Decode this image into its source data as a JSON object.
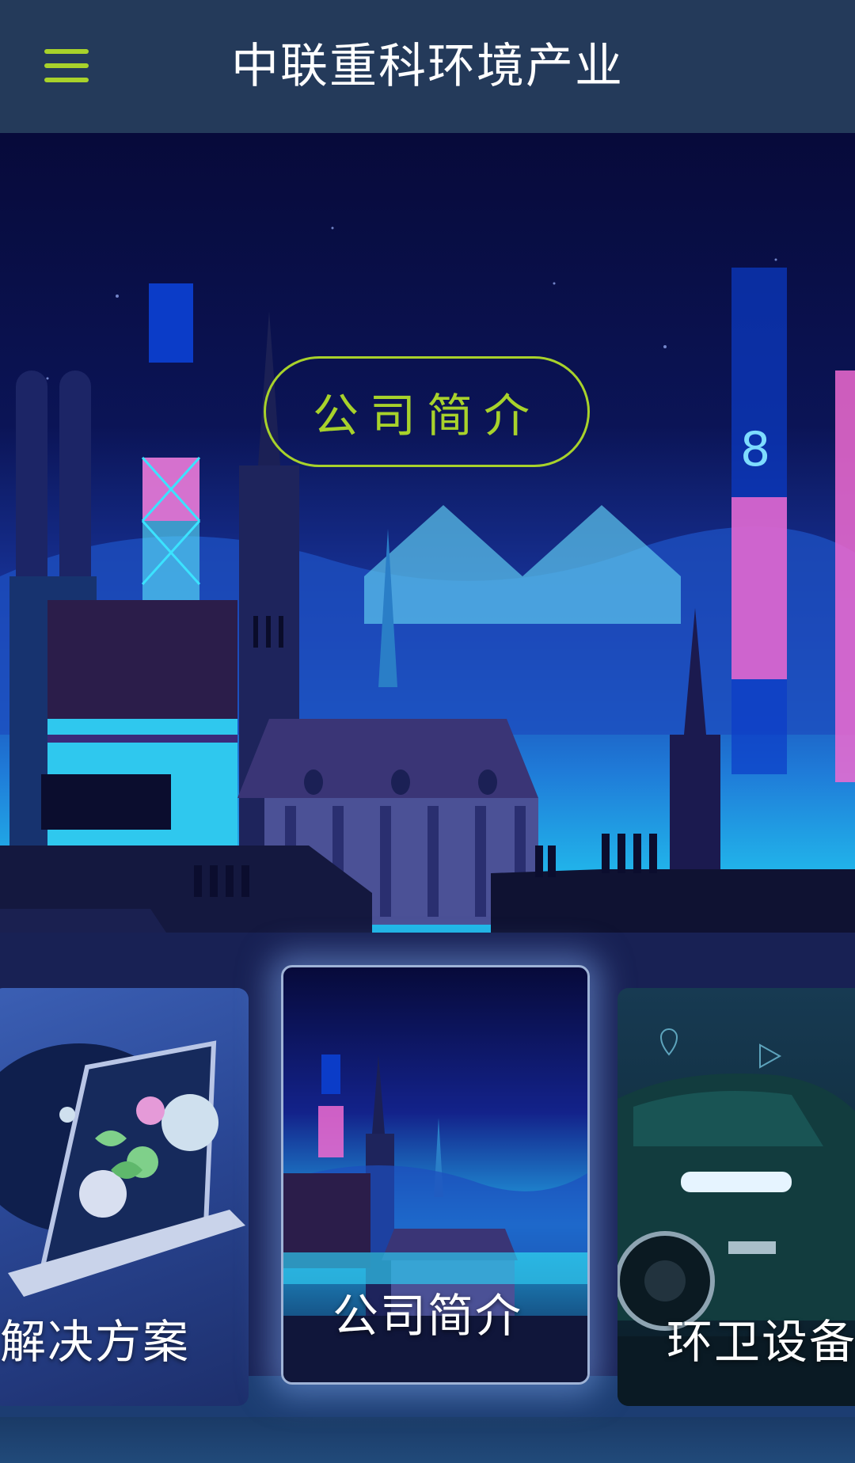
{
  "header": {
    "title": "中联重科环境产业",
    "menu_icon": "hamburger-menu-icon"
  },
  "hero": {
    "button_label": "公司简介"
  },
  "carousel": {
    "cards": [
      {
        "label": "解决方案",
        "image": "laptop-plants-illustration"
      },
      {
        "label": "公司简介",
        "image": "night-city-illustration"
      },
      {
        "label": "环卫设备",
        "image": "suv-car-illustration"
      }
    ]
  },
  "colors": {
    "header_bg": "#243a5a",
    "accent": "#a8d22b"
  }
}
